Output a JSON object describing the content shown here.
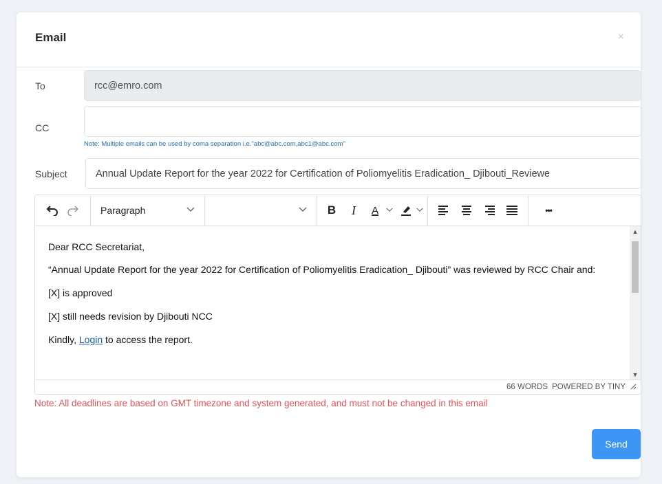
{
  "modal": {
    "title": "Email",
    "close_label": "×"
  },
  "fields": {
    "to_label": "To",
    "to_value": "rcc@emro.com",
    "cc_label": "CC",
    "cc_value": "",
    "cc_note": "Note: Multiple emails can be used by coma separation i.e.\"abc@abc.com,abc1@abc.com\"",
    "subject_label": "Subject",
    "subject_value": "Annual Update Report for the year 2022 for Certification of Poliomyelitis Eradication_ Djibouti_Reviewe"
  },
  "toolbar": {
    "block_format": "Paragraph",
    "font_family": "",
    "bold": "B",
    "italic": "I",
    "text_color": "A",
    "more": "•••"
  },
  "body": {
    "greeting": "Dear RCC Secretariat,",
    "line1": " “Annual Update Report for the year 2022 for Certification of Poliomyelitis Eradication_ Djibouti” was reviewed by RCC Chair and:",
    "line2": " [X] is approved",
    "line3": " [X] still needs revision by Djibouti NCC",
    "line4_pre": "Kindly, ",
    "line4_link": "Login",
    "line4_post": " to access the report."
  },
  "statusbar": {
    "word_count": "66 WORDS",
    "powered_by": "POWERED BY TINY"
  },
  "deadline_note": "Note: All deadlines are based on GMT timezone and system generated, and must not be changed in this email",
  "actions": {
    "send_label": "Send"
  },
  "colors": {
    "accent": "#3d96f5",
    "warning_text": "#e65157",
    "note_text": "#1f6fb5"
  }
}
